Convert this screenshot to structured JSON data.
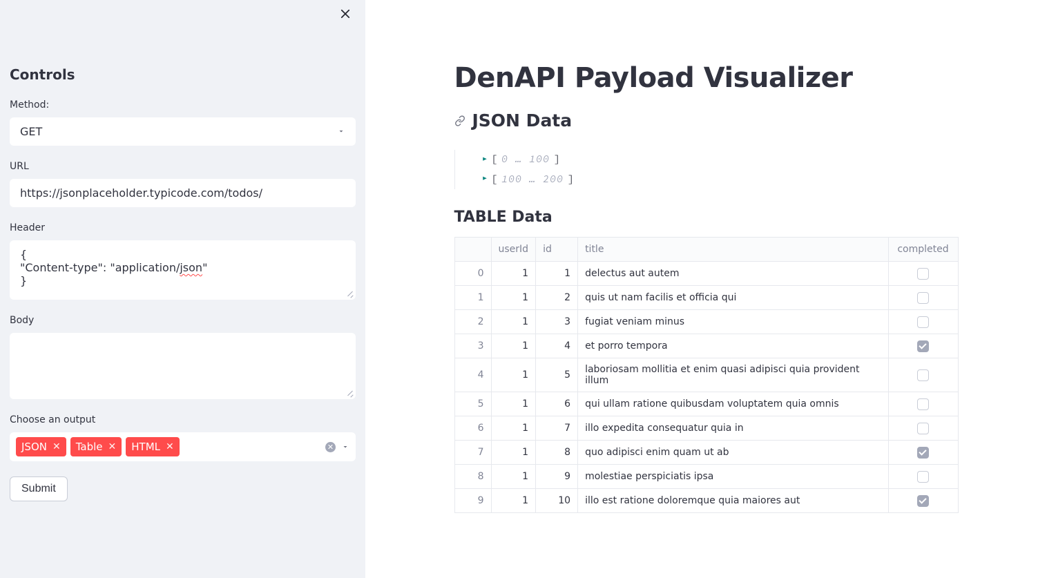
{
  "sidebar": {
    "title": "Controls",
    "close_title": "Close sidebar",
    "method": {
      "label": "Method:",
      "value": "GET"
    },
    "url": {
      "label": "URL",
      "value": "https://jsonplaceholder.typicode.com/todos/"
    },
    "header": {
      "label": "Header",
      "line1": "{",
      "line2_a": "\"Content-type\": \"application/",
      "line2_b": "json",
      "line2_c": "\"",
      "line3": "}"
    },
    "body": {
      "label": "Body",
      "value": ""
    },
    "output": {
      "label": "Choose an output",
      "tags": [
        "JSON",
        "Table",
        "HTML"
      ]
    },
    "submit_label": "Submit"
  },
  "main": {
    "title": "DenAPI Payload Visualizer",
    "json_section_title": "JSON Data",
    "table_section_title": "TABLE Data",
    "json_ranges": [
      {
        "start": 0,
        "end": 100
      },
      {
        "start": 100,
        "end": 200
      }
    ],
    "table": {
      "headers": {
        "index": "",
        "userId": "userId",
        "id": "id",
        "title": "title",
        "completed": "completed"
      },
      "rows": [
        {
          "index": 0,
          "userId": 1,
          "id": 1,
          "title": "delectus aut autem",
          "completed": false
        },
        {
          "index": 1,
          "userId": 1,
          "id": 2,
          "title": "quis ut nam facilis et officia qui",
          "completed": false
        },
        {
          "index": 2,
          "userId": 1,
          "id": 3,
          "title": "fugiat veniam minus",
          "completed": false
        },
        {
          "index": 3,
          "userId": 1,
          "id": 4,
          "title": "et porro tempora",
          "completed": true
        },
        {
          "index": 4,
          "userId": 1,
          "id": 5,
          "title": "laboriosam mollitia et enim quasi adipisci quia provident illum",
          "completed": false
        },
        {
          "index": 5,
          "userId": 1,
          "id": 6,
          "title": "qui ullam ratione quibusdam voluptatem quia omnis",
          "completed": false
        },
        {
          "index": 6,
          "userId": 1,
          "id": 7,
          "title": "illo expedita consequatur quia in",
          "completed": false
        },
        {
          "index": 7,
          "userId": 1,
          "id": 8,
          "title": "quo adipisci enim quam ut ab",
          "completed": true
        },
        {
          "index": 8,
          "userId": 1,
          "id": 9,
          "title": "molestiae perspiciatis ipsa",
          "completed": false
        },
        {
          "index": 9,
          "userId": 1,
          "id": 10,
          "title": "illo est ratione doloremque quia maiores aut",
          "completed": true
        }
      ]
    }
  }
}
